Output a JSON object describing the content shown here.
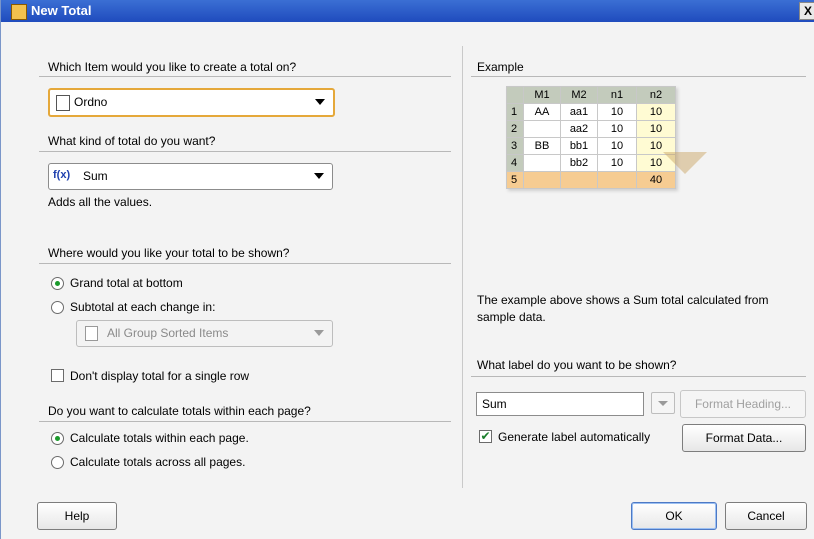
{
  "window": {
    "title": "New Total",
    "close_glyph": "X"
  },
  "left": {
    "q_item": "Which Item would you like to create a total on?",
    "item_combo_value": "Ordno",
    "q_kind": "What kind of total do you want?",
    "kind_combo_value": "Sum",
    "kind_icon_text": "f(x)",
    "kind_desc": "Adds all the values.",
    "q_where": "Where would you like your total to be shown?",
    "radio_grand": "Grand total at bottom",
    "radio_subtotal": "Subtotal at each change in:",
    "subtotal_combo_value": "All Group Sorted Items",
    "check_single_row": "Don't display total for a single row",
    "q_page": "Do you want to calculate totals within each page?",
    "radio_within": "Calculate totals within each page.",
    "radio_across": "Calculate totals across all pages."
  },
  "right": {
    "example_title": "Example",
    "table": {
      "headers": [
        "",
        "M1",
        "M2",
        "n1",
        "n2"
      ],
      "rows": [
        [
          "1",
          "AA",
          "aa1",
          "10",
          "10"
        ],
        [
          "2",
          "",
          "aa2",
          "10",
          "10"
        ],
        [
          "3",
          "BB",
          "bb1",
          "10",
          "10"
        ],
        [
          "4",
          "",
          "bb2",
          "10",
          "10"
        ],
        [
          "5",
          "",
          "",
          "",
          "40"
        ]
      ]
    },
    "example_desc": "The example above shows a Sum total calculated from sample data.",
    "q_label": "What label do you want to be shown?",
    "label_value": "Sum",
    "format_heading": "Format Heading...",
    "generate_label": "Generate label automatically",
    "format_data": "Format Data..."
  },
  "buttons": {
    "help": "Help",
    "ok": "OK",
    "cancel": "Cancel"
  },
  "colors": {
    "title_bar": "#1f4bbd",
    "accent_orange": "#e5a83a",
    "radio_green": "#1b9a2c",
    "total_row": "#f6cc92"
  }
}
